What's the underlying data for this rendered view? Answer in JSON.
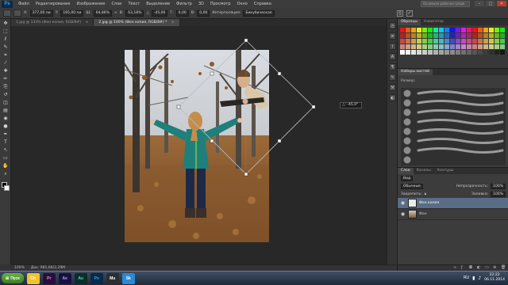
{
  "app": {
    "logo": "Ps"
  },
  "menu": {
    "items": [
      "Файл",
      "Редактирование",
      "Изображение",
      "Слои",
      "Текст",
      "Выделение",
      "Фильтр",
      "3D",
      "Просмотр",
      "Окно",
      "Справка"
    ]
  },
  "window": {
    "workspace": "Основная рабочая среда",
    "minimize": "–",
    "maximize": "□",
    "close": "✕"
  },
  "options": {
    "x_label": "X:",
    "x_value": "377,00 пи",
    "y_label": "Y:",
    "y_value": "165,00 пи",
    "w_label": "Ш:",
    "w_value": "64,86%",
    "h_label": "В:",
    "h_value": "63,18%",
    "angle_value": "-45,00",
    "h_skew_label": "Г:",
    "h_skew_value": "0,00",
    "v_skew_label": "В:",
    "v_skew_value": "0,00",
    "interpolation_label": "Интерполяция:",
    "interpolation_value": "Бикубическая",
    "cancel_icon": "cancel-icon",
    "commit_icon": "commit-icon"
  },
  "tabs": [
    {
      "label": "1.jpg @ 133% (Фон копия, RGB/8#)",
      "close": "×"
    },
    {
      "label": "2.jpg @ 100% (Фон копия, RGB/8#) *",
      "close": "×"
    }
  ],
  "toolbar": {
    "tools": [
      "move-icon",
      "marquee-icon",
      "lasso-icon",
      "quick-select-icon",
      "crop-icon",
      "eyedropper-icon",
      "healing-icon",
      "brush-icon",
      "clone-stamp-icon",
      "history-brush-icon",
      "eraser-icon",
      "gradient-icon",
      "blur-icon",
      "dodge-icon",
      "pen-icon",
      "type-icon",
      "path-select-icon",
      "shape-icon",
      "hand-icon",
      "zoom-icon"
    ],
    "glyphs": [
      "✥",
      "⬚",
      "ℓ",
      "✎",
      "⌗",
      "⁄",
      "✚",
      "✏",
      "⎘",
      "↺",
      "◫",
      "▤",
      "◉",
      "●",
      "✒",
      "T",
      "↖",
      "▭",
      "✋",
      "⌕"
    ],
    "foreground_color": "#000000",
    "background_color": "#ffffff"
  },
  "canvas": {
    "angle_tooltip": "△: -45,0°"
  },
  "status": {
    "zoom": "100%",
    "doc_size": "Док: 981,6K/2,29M"
  },
  "panels": {
    "color_tabs": [
      "Образцы",
      "Навигатор"
    ],
    "brush_tabs": [
      "Наборы кистей"
    ],
    "brush_size_label": "Размер:",
    "layers_tabs": [
      "Слои",
      "Каналы",
      "Контуры"
    ],
    "layers_kind": "Вид",
    "blend_mode": "Обычные",
    "opacity_label": "Непрозрачность:",
    "opacity_value": "100%",
    "lock_label": "Закрепить:",
    "fill_label": "Заливка:",
    "fill_value": "100%",
    "layers": [
      {
        "name": "Фон копия",
        "selected": true
      },
      {
        "name": "Фон",
        "selected": false
      }
    ]
  },
  "taskbar": {
    "start_label": "Пуск",
    "apps": [
      "Ch",
      "Pr",
      "Ae",
      "Au",
      "Ps",
      "Mu",
      "Sk"
    ],
    "language": "RU",
    "time": "22:22",
    "date": "06.11.2014"
  }
}
